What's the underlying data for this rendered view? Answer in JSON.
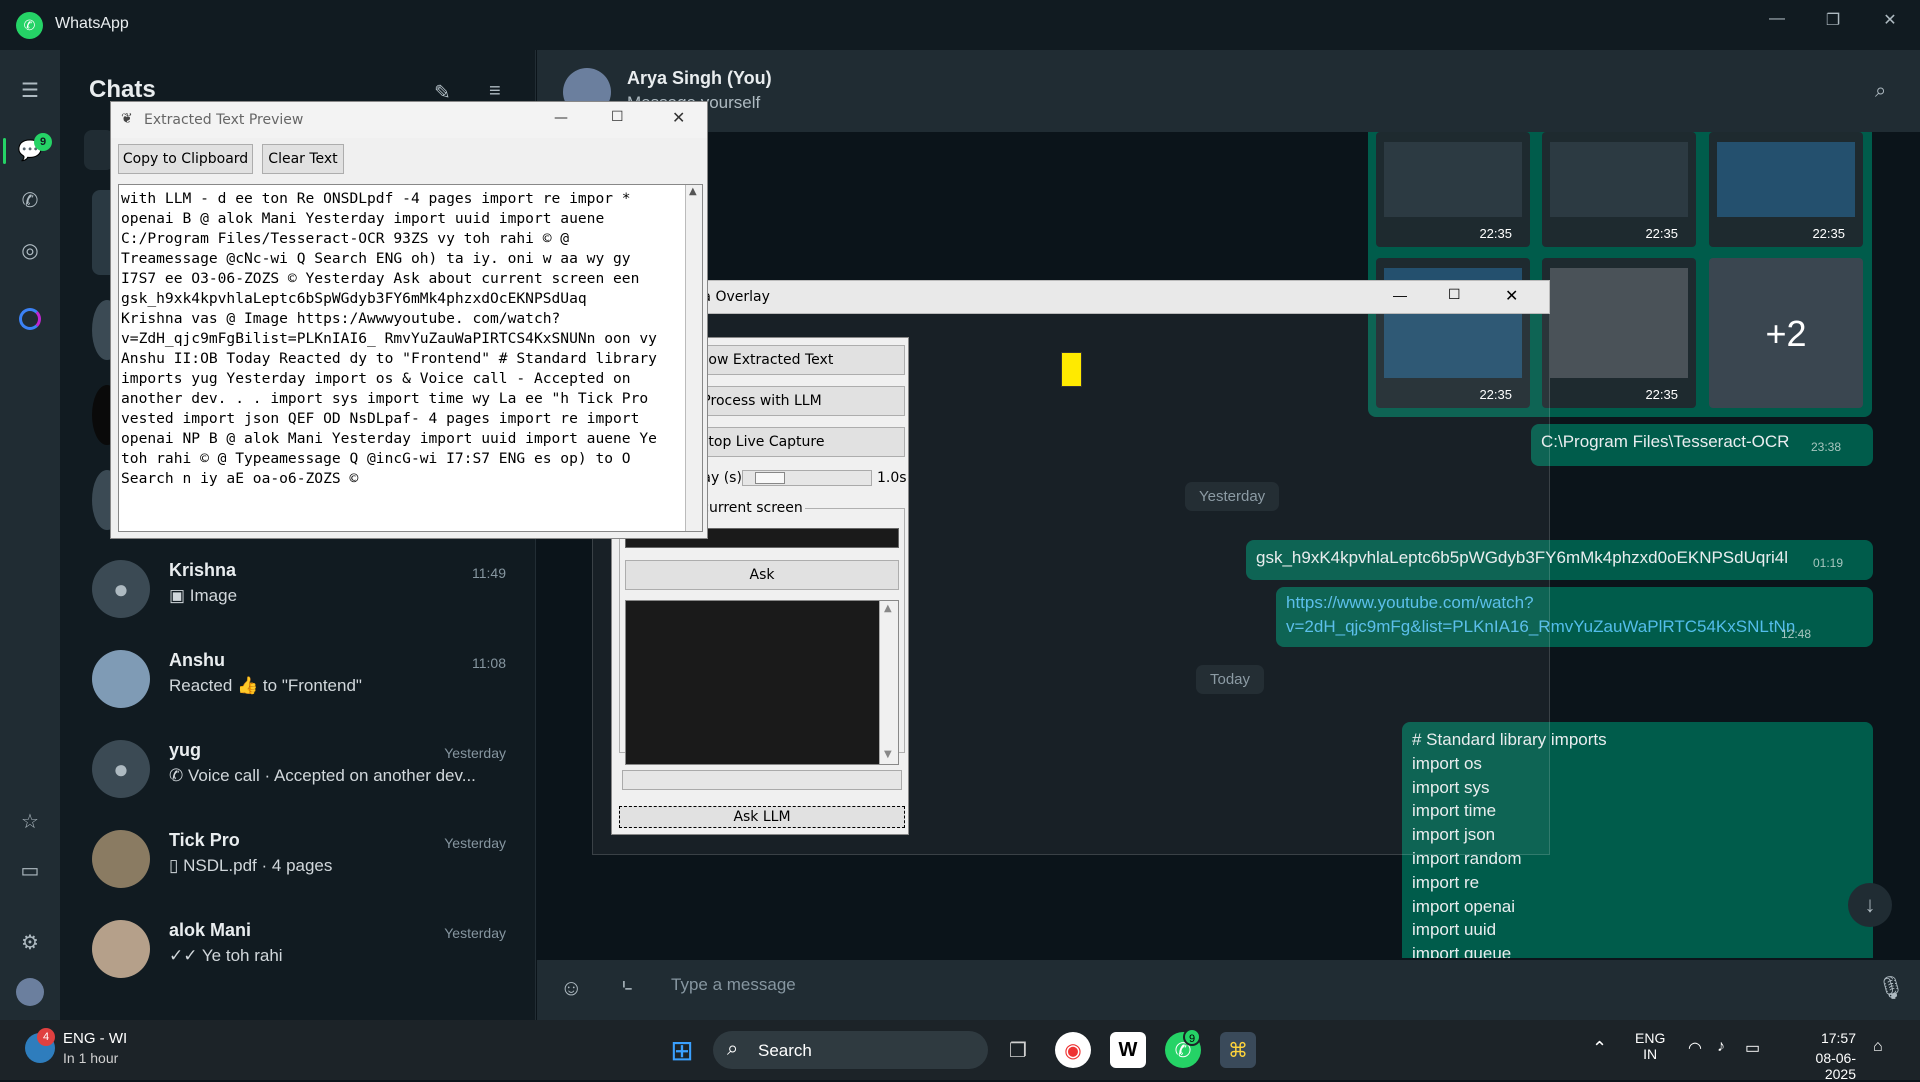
{
  "app": {
    "title": "WhatsApp"
  },
  "rail": {
    "chat_badge": "9"
  },
  "chatlist": {
    "title": "Chats",
    "chats": [
      {
        "name": "Krishna",
        "preview": "Image",
        "time": "11:49"
      },
      {
        "name": "Anshu",
        "preview": "Reacted 👍 to \"Frontend\"",
        "time": "11:08"
      },
      {
        "name": "yug",
        "preview": "Voice call · Accepted on another dev...",
        "time": "Yesterday"
      },
      {
        "name": "Tick Pro",
        "preview": "NSDL.pdf · 4 pages",
        "time": "Yesterday"
      },
      {
        "name": "alok Mani",
        "preview": "Ye toh rahi",
        "time": "Yesterday"
      }
    ]
  },
  "conversation": {
    "name": "Arya Singh (You)",
    "subtitle": "Message yourself",
    "thumb_times": [
      "22:35",
      "22:35",
      "22:35",
      "22:35",
      "22:35"
    ],
    "more_count": "+2",
    "messages": [
      {
        "text": "C:\\Program Files\\Tesseract-OCR",
        "time": "23:38"
      },
      {
        "text": "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",
        "time": "01:19"
      },
      {
        "text1": "https://www.youtube.com/watch?",
        "text2": "v=2dH_qjc9mFg&list=PLKnIA16_RmvYuZauWaPlRTC54KxSNLtNn",
        "time": "12:48"
      }
    ],
    "date_yesterday": "Yesterday",
    "date_today": "Today",
    "code_lines": [
      "# Standard library imports",
      "import os",
      "import sys",
      "import time",
      "import json",
      "import random",
      "import re",
      "import openai",
      "import uuid",
      "import queue"
    ],
    "composer_placeholder": "Type a message"
  },
  "extract_window": {
    "title": "Extracted Text Preview",
    "copy_label": "Copy to Clipboard",
    "clear_label": "Clear Text",
    "text": "with LLM - d ee ton Re ONSDLpdf -4 pages import re impor *\nopenai B @ alok Mani Yesterday import uuid import auene\nC:/Program Files/Tesseract-OCR 93ZS vy toh rahi © @\nTreamessage @cNc-wi Q Search ENG oh) ta iy. oni w aa wy gy\nI7S7 ee O3-06-ZOZS © Yesterday Ask about current screen een\ngsk_h9xk4kpvhlaLeptc6bSpWGdyb3FY6mMk4phzxdOcEKNPSdUaq\nKrishna vas @ Image https:/Awwwyoutube. com/watch?\nv=ZdH_qjc9mFgBilist=PLKnIAI6_ RmvYuZauWaPIRTCS4KxSNUNn oon vy\nAnshu II:OB Today Reacted dy to \"Frontend\" # Standard library\nimports yug Yesterday import os & Voice call - Accepted on\nanother dev. . . import sys import time wy La ee \"h Tick Pro\nvested import json QEF OD NsDLpaf- 4 pages import re import\nopenai NP B @ alok Mani Yesterday import uuid import auene Ye\ntoh rahi © @ Typeamessage Q @incG-wi I7:S7 ENG es op) to O\nSearch n iy aE oa-o6-ZOZS ©"
  },
  "overlay_window": {
    "title": "Screen Data Overlay",
    "show_label": "Show Extracted Text",
    "process_label": "Process with LLM",
    "stop_label": "Stop Live Capture",
    "delay_label": "Capture Delay (s):",
    "delay_value": "1.0s",
    "ask_group_label": "Ask about current screen",
    "ask_label": "Ask",
    "ask_llm_label": "Ask LLM"
  },
  "taskbar": {
    "weather_title": "ENG - WI",
    "weather_sub": "In 1 hour",
    "weather_badge": "4",
    "search": "Search",
    "lang1": "ENG",
    "lang2": "IN",
    "time": "17:57",
    "date": "08-06-2025",
    "wa_badge": "9"
  }
}
